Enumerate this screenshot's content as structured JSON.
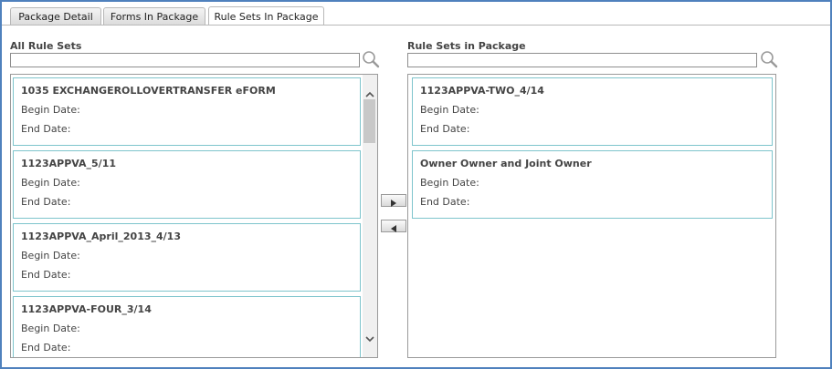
{
  "tabs": [
    {
      "label": "Package Detail"
    },
    {
      "label": "Forms In Package"
    },
    {
      "label": "Rule Sets In Package"
    }
  ],
  "left": {
    "heading": "All Rule Sets",
    "search_value": "",
    "items": [
      {
        "name": "1035 EXCHANGEROLLOVERTRANSFER eFORM",
        "begin_label": "Begin Date:",
        "end_label": "End Date:"
      },
      {
        "name": "1123APPVA_5/11",
        "begin_label": "Begin Date:",
        "end_label": "End Date:"
      },
      {
        "name": "1123APPVA_April_2013_4/13",
        "begin_label": "Begin Date:",
        "end_label": "End Date:"
      },
      {
        "name": "1123APPVA-FOUR_3/14",
        "begin_label": "Begin Date:",
        "end_label": "End Date:"
      }
    ]
  },
  "right": {
    "heading": "Rule Sets in Package",
    "search_value": "",
    "items": [
      {
        "name": "1123APPVA-TWO_4/14",
        "begin_label": "Begin Date:",
        "end_label": "End Date:"
      },
      {
        "name": "Owner Owner and Joint Owner",
        "begin_label": "Begin Date:",
        "end_label": "End Date:"
      }
    ]
  },
  "colors": {
    "frame": "#4f81bd",
    "card_border": "#7ec4cc"
  },
  "icons": {
    "search": "magnifier-icon",
    "move_right": "arrow-right-icon",
    "move_left": "arrow-left-icon",
    "scroll_up": "chevron-up-icon",
    "scroll_down": "chevron-down-icon"
  }
}
